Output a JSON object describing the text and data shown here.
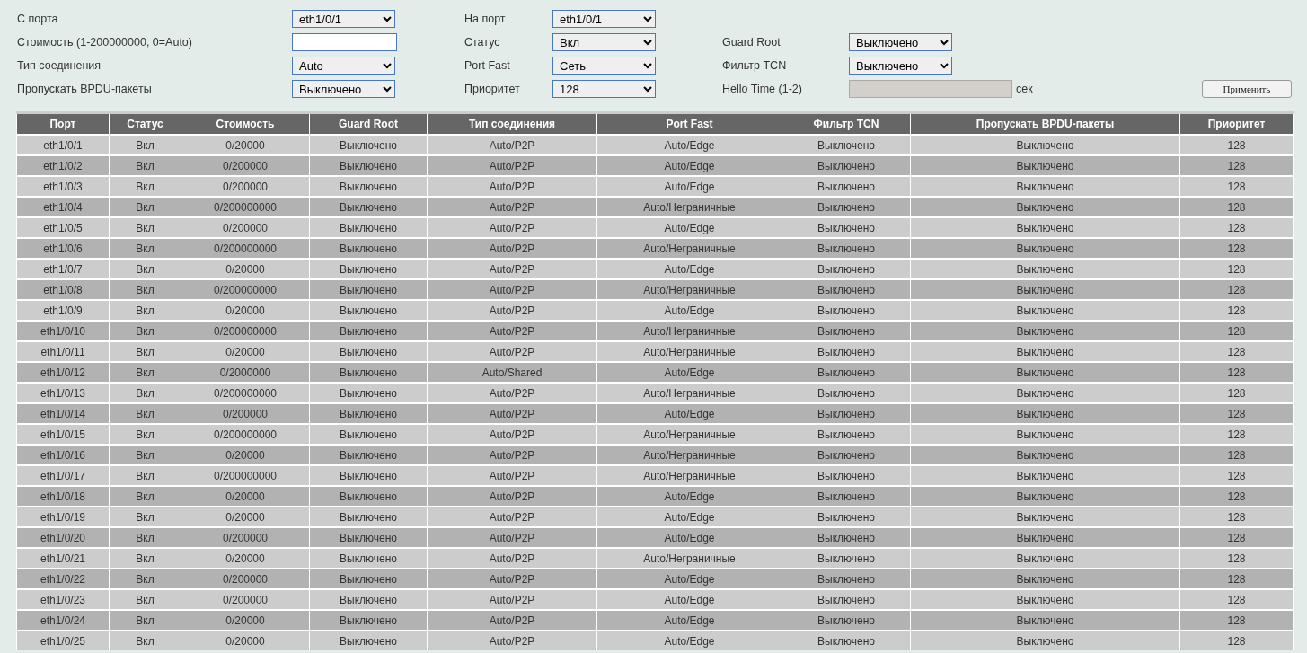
{
  "form": {
    "rows": [
      [
        {
          "label": "С порта",
          "kind": "select",
          "value": "eth1/0/1",
          "disabled": false
        },
        {
          "label": "На порт",
          "kind": "select",
          "value": "eth1/0/1",
          "disabled": false
        }
      ],
      [
        {
          "label": "Стоимость (1-200000000, 0=Auto)",
          "kind": "input",
          "disabled": false
        },
        {
          "label": "Статус",
          "kind": "select",
          "value": "Вкл",
          "disabled": false
        },
        {
          "label": "Guard Root",
          "kind": "select",
          "value": "Выключено",
          "disabled": false
        }
      ],
      [
        {
          "label": "Тип соединения",
          "kind": "select",
          "value": "Auto",
          "disabled": false
        },
        {
          "label": "Port Fast",
          "kind": "select",
          "value": "Сеть",
          "disabled": false
        },
        {
          "label": "Фильтр TCN",
          "kind": "select",
          "value": "Выключено",
          "disabled": false
        }
      ],
      [
        {
          "label": "Пропускать BPDU-пакеты",
          "kind": "select",
          "value": "Выключено",
          "disabled": false
        },
        {
          "label": "Приоритет",
          "kind": "select",
          "value": "128",
          "disabled": false
        },
        {
          "label": "Hello Time (1-2)",
          "kind": "input",
          "disabled": true,
          "unit": "сек"
        }
      ]
    ],
    "apply_button": "Применить"
  },
  "table": {
    "columns": [
      "Порт",
      "Статус",
      "Стоимость",
      "Guard Root",
      "Тип соединения",
      "Port Fast",
      "Фильтр TCN",
      "Пропускать BPDU-пакеты",
      "Приоритет"
    ],
    "rows": [
      [
        "eth1/0/1",
        "Вкл",
        "0/20000",
        "Выключено",
        "Auto/P2P",
        "Auto/Edge",
        "Выключено",
        "Выключено",
        "128"
      ],
      [
        "eth1/0/2",
        "Вкл",
        "0/200000",
        "Выключено",
        "Auto/P2P",
        "Auto/Edge",
        "Выключено",
        "Выключено",
        "128"
      ],
      [
        "eth1/0/3",
        "Вкл",
        "0/200000",
        "Выключено",
        "Auto/P2P",
        "Auto/Edge",
        "Выключено",
        "Выключено",
        "128"
      ],
      [
        "eth1/0/4",
        "Вкл",
        "0/200000000",
        "Выключено",
        "Auto/P2P",
        "Auto/Неграничные",
        "Выключено",
        "Выключено",
        "128"
      ],
      [
        "eth1/0/5",
        "Вкл",
        "0/200000",
        "Выключено",
        "Auto/P2P",
        "Auto/Edge",
        "Выключено",
        "Выключено",
        "128"
      ],
      [
        "eth1/0/6",
        "Вкл",
        "0/200000000",
        "Выключено",
        "Auto/P2P",
        "Auto/Неграничные",
        "Выключено",
        "Выключено",
        "128"
      ],
      [
        "eth1/0/7",
        "Вкл",
        "0/20000",
        "Выключено",
        "Auto/P2P",
        "Auto/Edge",
        "Выключено",
        "Выключено",
        "128"
      ],
      [
        "eth1/0/8",
        "Вкл",
        "0/200000000",
        "Выключено",
        "Auto/P2P",
        "Auto/Неграничные",
        "Выключено",
        "Выключено",
        "128"
      ],
      [
        "eth1/0/9",
        "Вкл",
        "0/20000",
        "Выключено",
        "Auto/P2P",
        "Auto/Edge",
        "Выключено",
        "Выключено",
        "128"
      ],
      [
        "eth1/0/10",
        "Вкл",
        "0/200000000",
        "Выключено",
        "Auto/P2P",
        "Auto/Неграничные",
        "Выключено",
        "Выключено",
        "128"
      ],
      [
        "eth1/0/11",
        "Вкл",
        "0/20000",
        "Выключено",
        "Auto/P2P",
        "Auto/Неграничные",
        "Выключено",
        "Выключено",
        "128"
      ],
      [
        "eth1/0/12",
        "Вкл",
        "0/2000000",
        "Выключено",
        "Auto/Shared",
        "Auto/Edge",
        "Выключено",
        "Выключено",
        "128"
      ],
      [
        "eth1/0/13",
        "Вкл",
        "0/200000000",
        "Выключено",
        "Auto/P2P",
        "Auto/Неграничные",
        "Выключено",
        "Выключено",
        "128"
      ],
      [
        "eth1/0/14",
        "Вкл",
        "0/200000",
        "Выключено",
        "Auto/P2P",
        "Auto/Edge",
        "Выключено",
        "Выключено",
        "128"
      ],
      [
        "eth1/0/15",
        "Вкл",
        "0/200000000",
        "Выключено",
        "Auto/P2P",
        "Auto/Неграничные",
        "Выключено",
        "Выключено",
        "128"
      ],
      [
        "eth1/0/16",
        "Вкл",
        "0/20000",
        "Выключено",
        "Auto/P2P",
        "Auto/Неграничные",
        "Выключено",
        "Выключено",
        "128"
      ],
      [
        "eth1/0/17",
        "Вкл",
        "0/200000000",
        "Выключено",
        "Auto/P2P",
        "Auto/Неграничные",
        "Выключено",
        "Выключено",
        "128"
      ],
      [
        "eth1/0/18",
        "Вкл",
        "0/20000",
        "Выключено",
        "Auto/P2P",
        "Auto/Edge",
        "Выключено",
        "Выключено",
        "128"
      ],
      [
        "eth1/0/19",
        "Вкл",
        "0/20000",
        "Выключено",
        "Auto/P2P",
        "Auto/Edge",
        "Выключено",
        "Выключено",
        "128"
      ],
      [
        "eth1/0/20",
        "Вкл",
        "0/200000",
        "Выключено",
        "Auto/P2P",
        "Auto/Edge",
        "Выключено",
        "Выключено",
        "128"
      ],
      [
        "eth1/0/21",
        "Вкл",
        "0/20000",
        "Выключено",
        "Auto/P2P",
        "Auto/Неграничные",
        "Выключено",
        "Выключено",
        "128"
      ],
      [
        "eth1/0/22",
        "Вкл",
        "0/200000",
        "Выключено",
        "Auto/P2P",
        "Auto/Edge",
        "Выключено",
        "Выключено",
        "128"
      ],
      [
        "eth1/0/23",
        "Вкл",
        "0/200000",
        "Выключено",
        "Auto/P2P",
        "Auto/Edge",
        "Выключено",
        "Выключено",
        "128"
      ],
      [
        "eth1/0/24",
        "Вкл",
        "0/20000",
        "Выключено",
        "Auto/P2P",
        "Auto/Edge",
        "Выключено",
        "Выключено",
        "128"
      ],
      [
        "eth1/0/25",
        "Вкл",
        "0/20000",
        "Выключено",
        "Auto/P2P",
        "Auto/Edge",
        "Выключено",
        "Выключено",
        "128"
      ]
    ]
  }
}
